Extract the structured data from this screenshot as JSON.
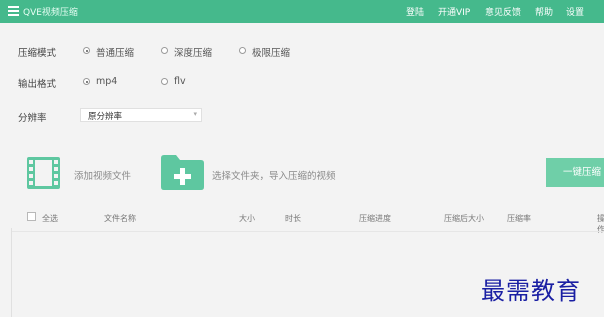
{
  "titlebar": {
    "title": "QVE视频压缩",
    "menu": [
      "登陆",
      "开通VIP",
      "意见反馈",
      "帮助",
      "设置"
    ]
  },
  "options": {
    "compress_mode": {
      "label": "压缩模式",
      "choices": [
        "普通压缩",
        "深度压缩",
        "极限压缩"
      ],
      "selected": "普通压缩"
    },
    "output_format": {
      "label": "输出格式",
      "choices": [
        "mp4",
        "flv"
      ],
      "selected": "mp4"
    },
    "resolution": {
      "label": "分辨率",
      "value": "原分辨率"
    }
  },
  "actions": {
    "add_video": "添加视频文件",
    "select_folder": "选择文件夹，导入压缩的视频",
    "compress_button": "一键压缩"
  },
  "table": {
    "select_all": "全选",
    "columns": [
      "文件名称",
      "大小",
      "时长",
      "压缩进度",
      "压缩后大小",
      "压缩率",
      "操作"
    ]
  },
  "watermark": "最需教育",
  "colors": {
    "brand": "#45b98c",
    "button": "#6fcfa8",
    "icon": "#5ec7a0"
  }
}
